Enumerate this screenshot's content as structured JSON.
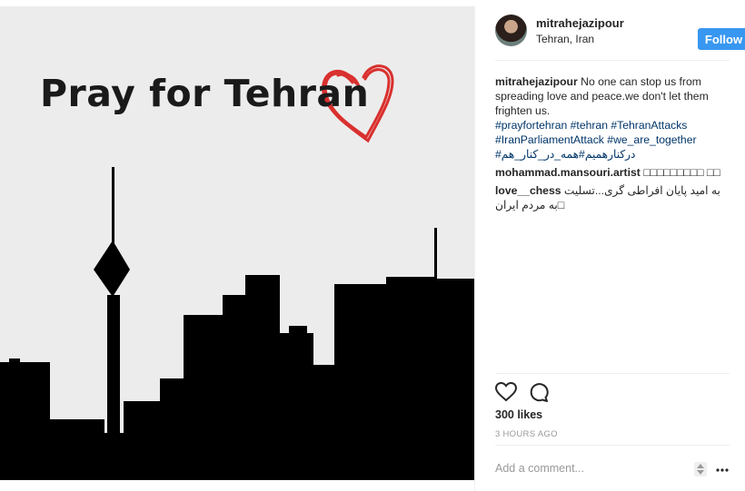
{
  "post": {
    "poster_text": "Pray for Tehran",
    "author": {
      "username": "mitrahejazipour",
      "location": "Tehran, Iran",
      "follow_label": "Follow",
      "follow_color": "#3897f0"
    },
    "caption": {
      "username": "mitrahejazipour",
      "text": "No one can stop us from spreading love and peace.we don't let them frighten us.",
      "hashtags": "#prayfortehran #tehran #TehranAttacks #IranParliamentAttack #we_are_together",
      "hashtags_persian": "#درکنارهمیم#همه_در_کنار_هم"
    },
    "comments": [
      {
        "username": "mohammad.mansouri.artist",
        "text": "□□□□□□□□□ □□"
      },
      {
        "username": "love__chess",
        "text": "به امید پایان افراطی گری...تسلیت به مردم ایران□"
      }
    ],
    "likes": "300 likes",
    "timestamp": "3 HOURS AGO",
    "add_comment_placeholder": "Add a comment...",
    "icons": [
      "heart-icon",
      "comment-icon",
      "sort-arrows-icon",
      "more-options-icon"
    ],
    "link_color": "#003569"
  }
}
